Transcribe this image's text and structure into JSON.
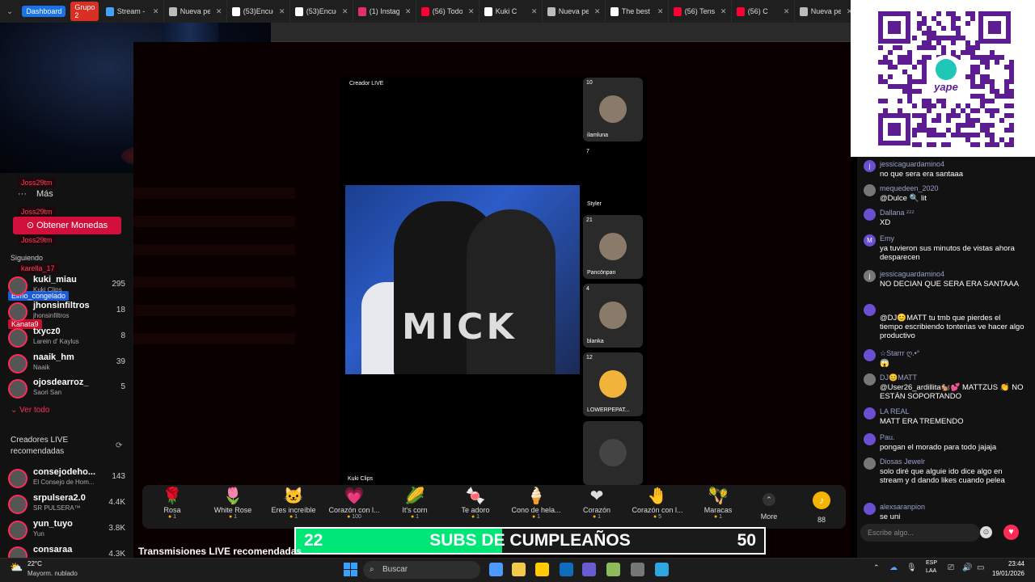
{
  "browser": {
    "tabs": [
      {
        "label": "Stream - Ki",
        "color": "#3fa4ff"
      },
      {
        "label": "Nueva pes",
        "color": "#bbbbbb"
      },
      {
        "label": "(53)Encuer",
        "color": "#ffffff"
      },
      {
        "label": "(53)Encuen",
        "color": "#ffffff"
      },
      {
        "label": "(1) Instagra",
        "color": "#e1306c"
      },
      {
        "label": "(56) Todo T",
        "color": "#ff0033"
      },
      {
        "label": "Kuki C",
        "color": "#ffffff"
      },
      {
        "label": "Nueva pes",
        "color": "#bbbbbb"
      },
      {
        "label": "The best C",
        "color": "#ffffff"
      },
      {
        "label": "(56) Tense",
        "color": "#ff0033"
      },
      {
        "label": "(56) C",
        "color": "#ff0033"
      },
      {
        "label": "Nueva pes",
        "color": "#bbbbbb"
      }
    ],
    "groups": [
      {
        "label": "Dashboard",
        "color": "#1a73e8"
      },
      {
        "label": "Grupo 2",
        "color": "#d93025"
      }
    ]
  },
  "sidebar": {
    "more_label": "Más",
    "coins_button": "Obtener Monedas",
    "following_label": "Siguiendo",
    "overlays": {
      "joss1": "Joss29tm",
      "joss2": "Joss29tm",
      "joss3": "Joss29tm",
      "karella": "karella_17",
      "elmo": "Elmo_congelado",
      "kanata": "Kanata9"
    },
    "following": [
      {
        "name": "kuki_miau",
        "sub": "Kuki Clips",
        "count": "295"
      },
      {
        "name": "jhonsinfiltros",
        "sub": "jhonsinfiltros",
        "count": "18"
      },
      {
        "name": "txycz0",
        "sub": "Larein d' Kaylus",
        "count": "8"
      },
      {
        "name": "naaik_hm",
        "sub": "Naaik",
        "count": "39"
      },
      {
        "name": "ojosdearroz_",
        "sub": "Saori San",
        "count": "5"
      }
    ],
    "see_all": "Ver todo",
    "recommended_title": "Creadores LIVE recomendadas",
    "recommended": [
      {
        "name": "consejodeho...",
        "sub": "El Consejo de Hom...",
        "count": "143"
      },
      {
        "name": "srpulsera2.0",
        "sub": "SR PULSERA™",
        "count": "4.4K"
      },
      {
        "name": "yun_tuyo",
        "sub": "Yun",
        "count": "3.8K"
      },
      {
        "name": "consaraa",
        "sub": "",
        "count": "4.3K"
      }
    ]
  },
  "stream": {
    "creator_label": "Creador LIVE",
    "bottom_label": "Kuki Clips",
    "watermark": "MICK",
    "guests": [
      {
        "num": "10",
        "name": "ilamluna"
      },
      {
        "num": "7",
        "name": "Styler"
      },
      {
        "num": "21",
        "name": "Pancönpan"
      },
      {
        "num": "4",
        "name": "blanka"
      },
      {
        "num": "12",
        "name": "LOWERPEPAT..."
      },
      {
        "num": "",
        "name": ""
      }
    ],
    "recommended_title": "Transmisiones LIVE recomendadas"
  },
  "gifts": [
    {
      "name": "Rosa",
      "price": "1",
      "icon": "🌹"
    },
    {
      "name": "White Rose",
      "price": "1",
      "icon": "🌷"
    },
    {
      "name": "Eres increíble",
      "price": "1",
      "icon": "🐱"
    },
    {
      "name": "Corazón con l...",
      "price": "100",
      "icon": "💗"
    },
    {
      "name": "It's corn",
      "price": "1",
      "icon": "🌽"
    },
    {
      "name": "Te adoro",
      "price": "1",
      "icon": "🍬"
    },
    {
      "name": "Cono de hela...",
      "price": "1",
      "icon": "🍦"
    },
    {
      "name": "Corazón",
      "price": "1",
      "icon": "❤"
    },
    {
      "name": "Corazón con l...",
      "price": "5",
      "icon": "🤚"
    },
    {
      "name": "Maracas",
      "price": "1",
      "icon": "🪇"
    }
  ],
  "gift_more": "More",
  "coin_count": "88",
  "banner": {
    "left_num": "22",
    "text": "SUBS DE CUMPLEAÑOS",
    "right_num": "50",
    "progress": 0.44
  },
  "chat": {
    "messages": [
      {
        "user": "jessicaguardamino4",
        "text": "no que sera era santaaa",
        "initial": "j"
      },
      {
        "user": "mequedeen_2020",
        "text": "@Dulce 🔍 lit",
        "initial": ""
      },
      {
        "user": "Dallana ᶻᶻᶻ",
        "text": "XD",
        "initial": ""
      },
      {
        "user": "Emy",
        "text": "ya tuvieron sus minutos de vistas ahora desparecen",
        "initial": "M"
      },
      {
        "user": "jessicaguardamino4",
        "text": "NO DECIAN QUE SERA ERA SANTAAA",
        "initial": "j"
      },
      {
        "user": "",
        "text": "@DJ😊MATT tu tmb que pierdes el tiempo escribiendo tonterias ve hacer algo productivo",
        "initial": ""
      },
      {
        "user": "☆Starrr ღ.•°",
        "text": "😱",
        "initial": ""
      },
      {
        "user": "DJ😊MATT",
        "text": "@User26_ardillita🐿️💕 MATTZUS 👏 NO ESTÁN SOPORTANDO",
        "initial": ""
      },
      {
        "user": "LA REAL",
        "text": "MATT ERA TREMENDO",
        "initial": ""
      },
      {
        "user": "Pau.",
        "text": "pongan el morado para todo jajaja",
        "initial": ""
      },
      {
        "user": "Diosas Jewelr",
        "text": "solo diré que alguie    ido dice algo en stream y d       dando likes cuando pelea",
        "initial": ""
      },
      {
        "user": "alexsaranpion",
        "text": "se uni",
        "initial": ""
      }
    ],
    "input_placeholder": "Escribe algo..."
  },
  "taskbar": {
    "weather_temp": "22°C",
    "weather_desc": "Mayorm. nublado",
    "search": "Buscar",
    "lang": "ESP",
    "lang2": "LAA",
    "time": "23:44",
    "date": "19/01/2026"
  }
}
